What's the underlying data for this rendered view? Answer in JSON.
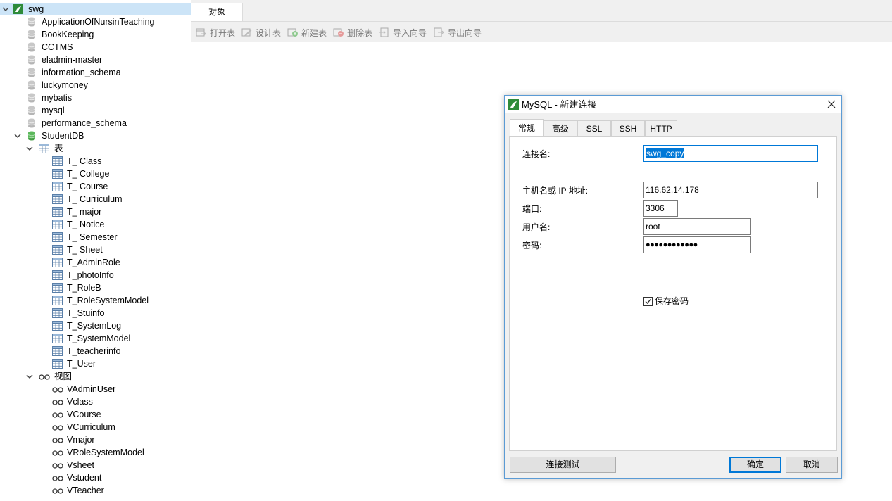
{
  "connection_tree": {
    "root": {
      "label": "swg"
    },
    "databases": [
      "ApplicationOfNursinTeaching",
      "BookKeeping",
      "CCTMS",
      "eladmin-master",
      "information_schema",
      "luckymoney",
      "mybatis",
      "mysql",
      "performance_schema"
    ],
    "open_database": {
      "label": "StudentDB",
      "tables_folder": "表",
      "tables": [
        "T_ Class",
        "T_ College",
        "T_ Course",
        "T_ Curriculum",
        "T_ major",
        "T_ Notice",
        "T_ Semester",
        "T_ Sheet",
        "T_AdminRole",
        "T_photoInfo",
        "T_RoleB",
        "T_RoleSystemModel",
        "T_Stuinfo",
        "T_SystemLog",
        "T_SystemModel",
        "T_teacherinfo",
        "T_User"
      ],
      "views_folder": "视图",
      "views": [
        "VAdminUser",
        "Vclass",
        "VCourse",
        "VCurriculum",
        "Vmajor",
        "VRoleSystemModel",
        "Vsheet",
        "Vstudent",
        "VTeacher"
      ]
    }
  },
  "main_tabs": {
    "objects": "对象"
  },
  "toolbar": {
    "open_table": "打开表",
    "design_table": "设计表",
    "new_table": "新建表",
    "delete_table": "删除表",
    "import_wizard": "导入向导",
    "export_wizard": "导出向导"
  },
  "dialog": {
    "title": "MySQL - 新建连接",
    "tabs": [
      "常规",
      "高级",
      "SSL",
      "SSH",
      "HTTP"
    ],
    "fields": {
      "connection_name_label": "连接名:",
      "connection_name_value": "swg_copy",
      "host_label": "主机名或 IP 地址:",
      "host_value": "116.62.14.178",
      "port_label": "端口:",
      "port_value": "3306",
      "user_label": "用户名:",
      "user_value": "root",
      "password_label": "密码:",
      "password_value": "●●●●●●●●●●●●",
      "save_password_label": "保存密码",
      "save_password_checked": true
    },
    "buttons": {
      "test": "连接测试",
      "ok": "确定",
      "cancel": "取消"
    }
  },
  "colors": {
    "accent": "#0078d7",
    "db_icon_green": "#4caf50",
    "navicat_green": "#2e8b3a"
  }
}
